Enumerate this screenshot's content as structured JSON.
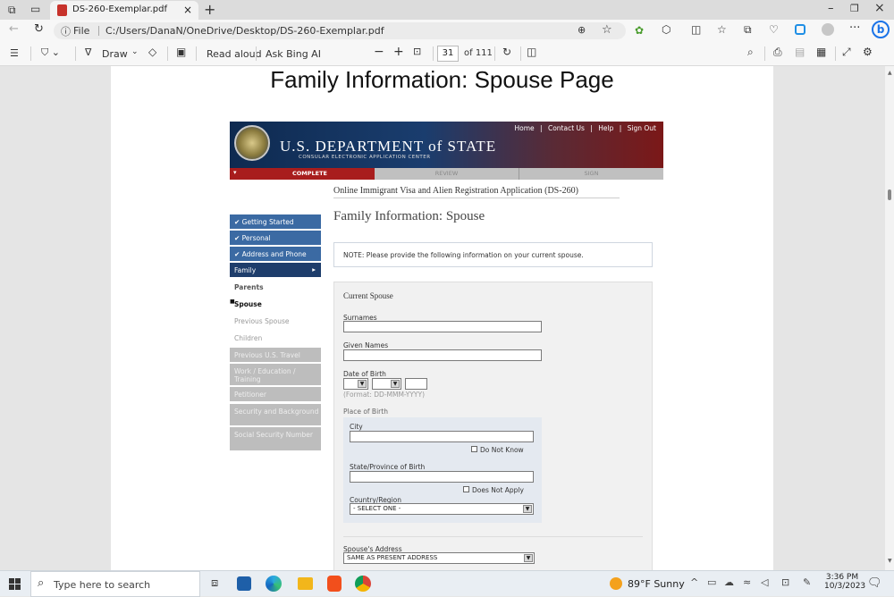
{
  "browser": {
    "tab_title": "DS-260-Exemplar.pdf",
    "url_prefix": "File",
    "url": "C:/Users/DanaN/OneDrive/Desktop/DS-260-Exemplar.pdf"
  },
  "pdf_toolbar": {
    "draw": "Draw",
    "read_aloud": "Read aloud",
    "ask_bing": "Ask Bing AI",
    "page_current": "31",
    "page_total": "of 111"
  },
  "doc": {
    "slide_title": "Family Information: Spouse Page"
  },
  "site": {
    "top_links": [
      "Home",
      "Contact Us",
      "Help",
      "Sign Out"
    ],
    "logo_line1": "U.S. DEPARTMENT of STATE",
    "logo_line2": "CONSULAR ELECTRONIC APPLICATION CENTER",
    "steps": [
      "COMPLETE",
      "REVIEW",
      "SIGN"
    ],
    "app_title": "Online Immigrant Visa and Alien Registration Application (DS-260)",
    "page_heading": "Family Information: Spouse",
    "note": "NOTE: Please provide the following information on your current spouse."
  },
  "sidebar": [
    {
      "label": "✔ Getting Started"
    },
    {
      "label": "✔ Personal"
    },
    {
      "label": "✔ Address and Phone"
    },
    {
      "label": "Family"
    },
    {
      "label": "Parents"
    },
    {
      "label": "Spouse"
    },
    {
      "label": "Previous Spouse"
    },
    {
      "label": "Children"
    },
    {
      "label": "Previous U.S. Travel"
    },
    {
      "label": "Work / Education / Training"
    },
    {
      "label": "Petitioner"
    },
    {
      "label": "Security and Background"
    },
    {
      "label": "Social Security Number"
    }
  ],
  "form": {
    "section_title": "Current Spouse",
    "surnames_label": "Surnames",
    "given_names_label": "Given Names",
    "dob_label": "Date of Birth",
    "dob_format": "(Format: DD-MMM-YYYY)",
    "pob_label": "Place of Birth",
    "city_label": "City",
    "do_not_know": "Do Not Know",
    "state_label": "State/Province of Birth",
    "does_not_apply": "Does Not Apply",
    "country_label": "Country/Region",
    "country_value": "- SELECT ONE -",
    "address_label": "Spouse's Address",
    "address_value": "SAME AS PRESENT ADDRESS"
  },
  "taskbar": {
    "search_placeholder": "Type here to search",
    "weather": "89°F  Sunny",
    "time": "3:36 PM",
    "date": "10/3/2023"
  }
}
